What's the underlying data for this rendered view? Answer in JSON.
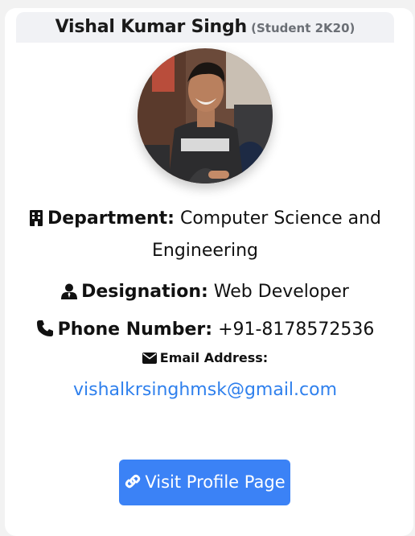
{
  "profile": {
    "name": "Vishal Kumar Singh",
    "role": "(Student 2K20)"
  },
  "details": {
    "department_label": "Department:",
    "department_value": "Computer Science and Engineering",
    "designation_label": "Designation:",
    "designation_value": "Web Developer",
    "phone_label": "Phone Number:",
    "phone_value": "+91-8178572536",
    "email_label": "Email Address:",
    "email_value": "vishalkrsinghmsk@gmail.com"
  },
  "actions": {
    "visit_label": "Visit Profile Page"
  },
  "colors": {
    "accent": "#3b82f6",
    "link": "#2f80ed",
    "header_bg": "#f1f2f5"
  },
  "icons": {
    "department": "building-icon",
    "designation": "user-tie-icon",
    "phone": "phone-icon",
    "email": "envelope-icon",
    "visit": "link-icon"
  }
}
